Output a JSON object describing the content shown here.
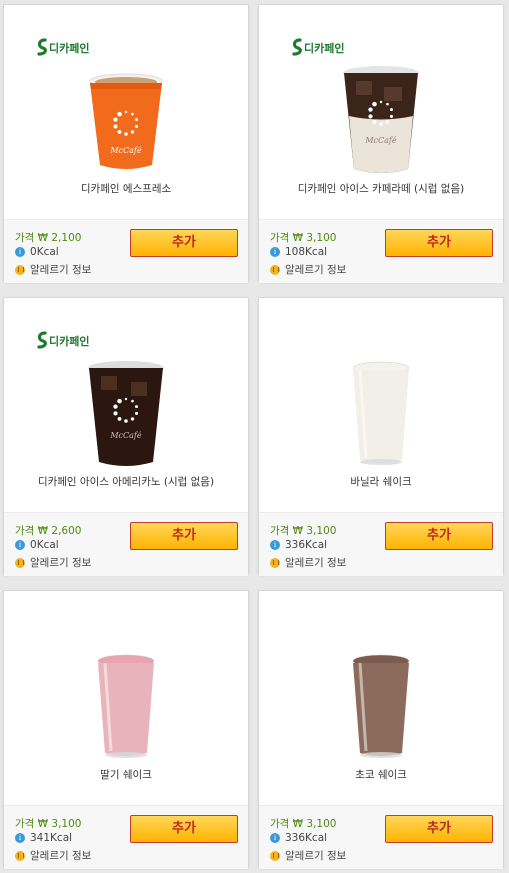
{
  "labels": {
    "decaf_badge": "디카페인",
    "add_button": "추가",
    "allergy_info": "알레르기 정보",
    "price_prefix": "가격 ₩ ",
    "kcal_suffix": " Kcal"
  },
  "products": [
    {
      "name": "디카페인 에스프레소",
      "price": "2,100",
      "kcal": "0",
      "decaf": true,
      "image": "hot-orange-cup"
    },
    {
      "name": "디카페인 아이스 카페라떼 (시럽 없음)",
      "price": "3,100",
      "kcal": "108",
      "decaf": true,
      "image": "iced-latte"
    },
    {
      "name": "디카페인 아이스 아메리카노 (시럽 없음)",
      "price": "2,600",
      "kcal": "0",
      "decaf": true,
      "image": "iced-americano"
    },
    {
      "name": "바닐라 쉐이크",
      "price": "3,100",
      "kcal": "336",
      "decaf": false,
      "image": "vanilla-shake"
    },
    {
      "name": "딸기 쉐이크",
      "price": "3,100",
      "kcal": "341",
      "decaf": false,
      "image": "strawberry-shake"
    },
    {
      "name": "초코 쉐이크",
      "price": "3,100",
      "kcal": "336",
      "decaf": false,
      "image": "chocolate-shake"
    }
  ],
  "colors": {
    "decaf_green": "#1f7a2e",
    "price_green": "#4f8a10",
    "button_yellow": "#ffc21e",
    "button_border": "#c33b2b",
    "info_blue": "#3a9ad9"
  }
}
